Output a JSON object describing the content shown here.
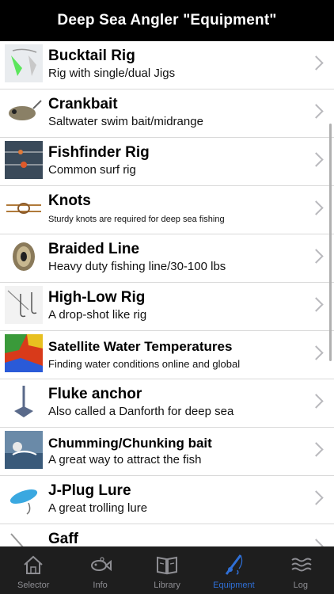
{
  "header": {
    "title": "Deep Sea Angler \"Equipment\""
  },
  "items": [
    {
      "title": "Bucktail Rig",
      "subtitle": "Rig with single/dual Jigs"
    },
    {
      "title": "Crankbait",
      "subtitle": "Saltwater swim bait/midrange"
    },
    {
      "title": "Fishfinder Rig",
      "subtitle": "Common surf rig"
    },
    {
      "title": "Knots",
      "subtitle": "Sturdy knots are required for deep sea fishing"
    },
    {
      "title": "Braided Line",
      "subtitle": "Heavy duty fishing line/30-100 lbs"
    },
    {
      "title": "High-Low Rig",
      "subtitle": "A drop-shot like rig"
    },
    {
      "title": "Satellite Water Temperatures",
      "subtitle": "Finding water conditions online and global"
    },
    {
      "title": "Fluke anchor",
      "subtitle": "Also called a Danforth for deep sea"
    },
    {
      "title": "Chumming/Chunking bait",
      "subtitle": "A great way to attract the fish"
    },
    {
      "title": "J-Plug Lure",
      "subtitle": "A great trolling lure"
    },
    {
      "title": "Gaff",
      "subtitle": ""
    }
  ],
  "tabs": [
    {
      "label": "Selector",
      "icon": "house-icon"
    },
    {
      "label": "Info",
      "icon": "fish-info-icon"
    },
    {
      "label": "Library",
      "icon": "book-icon"
    },
    {
      "label": "Equipment",
      "icon": "fishing-rod-icon",
      "active": true
    },
    {
      "label": "Log",
      "icon": "waves-icon"
    }
  ],
  "colors": {
    "header_bg": "#000000",
    "tabbar_bg": "#1e1e1e",
    "active_tab": "#2f6fd6",
    "inactive_tab": "#8e8e93"
  }
}
